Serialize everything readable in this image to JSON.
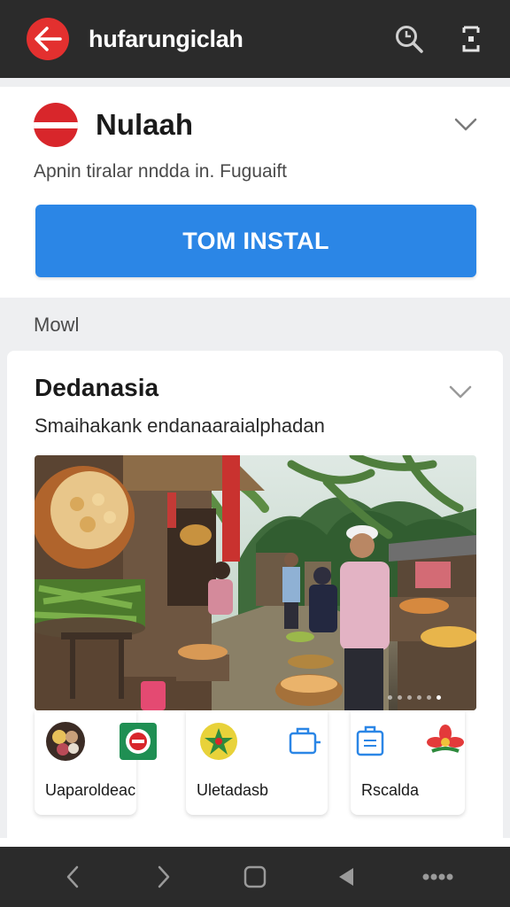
{
  "topbar": {
    "title": "hufarungiclah",
    "back_icon": "arrow-left-icon",
    "search_icon": "search-icon",
    "menu_icon": "more-vert-icon"
  },
  "app": {
    "name": "Nulaah",
    "subtitle": "Apnin tiralar nndda in. Fuguaift",
    "install_label": "TOM INSTAL"
  },
  "section": {
    "label": "Mowl"
  },
  "feature": {
    "title": "Dedanasia",
    "subtitle": "Smaihakank endanaaraialphadan",
    "carousel_pages": 6,
    "carousel_active": 6,
    "tiles": [
      {
        "label": "Uaparoldeac"
      },
      {
        "label": "Uletadasb"
      },
      {
        "label": "Rscalda"
      }
    ]
  },
  "navbar": {
    "items": [
      "back-icon",
      "forward-icon",
      "home-icon",
      "play-icon",
      "more-icon"
    ]
  },
  "colors": {
    "accent": "#2b86e6",
    "brand_red": "#d8262b",
    "bar": "#2b2b2b"
  }
}
